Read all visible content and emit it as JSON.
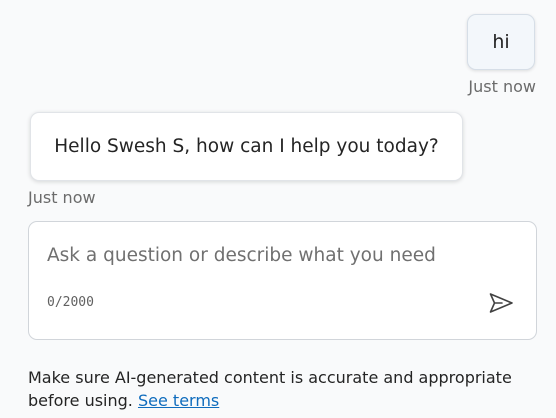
{
  "conversation": {
    "user_message": {
      "text": "hi",
      "timestamp": "Just now"
    },
    "bot_message": {
      "text": "Hello Swesh S, how can I help you today?",
      "timestamp": "Just now"
    }
  },
  "composer": {
    "placeholder": "Ask a question or describe what you need",
    "char_count": "0/2000",
    "send_icon": "send-icon"
  },
  "disclaimer": {
    "text": "Make sure AI-generated content is accurate and appropriate before using.",
    "link_label": "See terms"
  },
  "colors": {
    "link": "#0f6cbd",
    "user_bubble_bg": "#f3f7fb",
    "bot_bubble_bg": "#ffffff",
    "page_bg": "#f9fafb"
  }
}
